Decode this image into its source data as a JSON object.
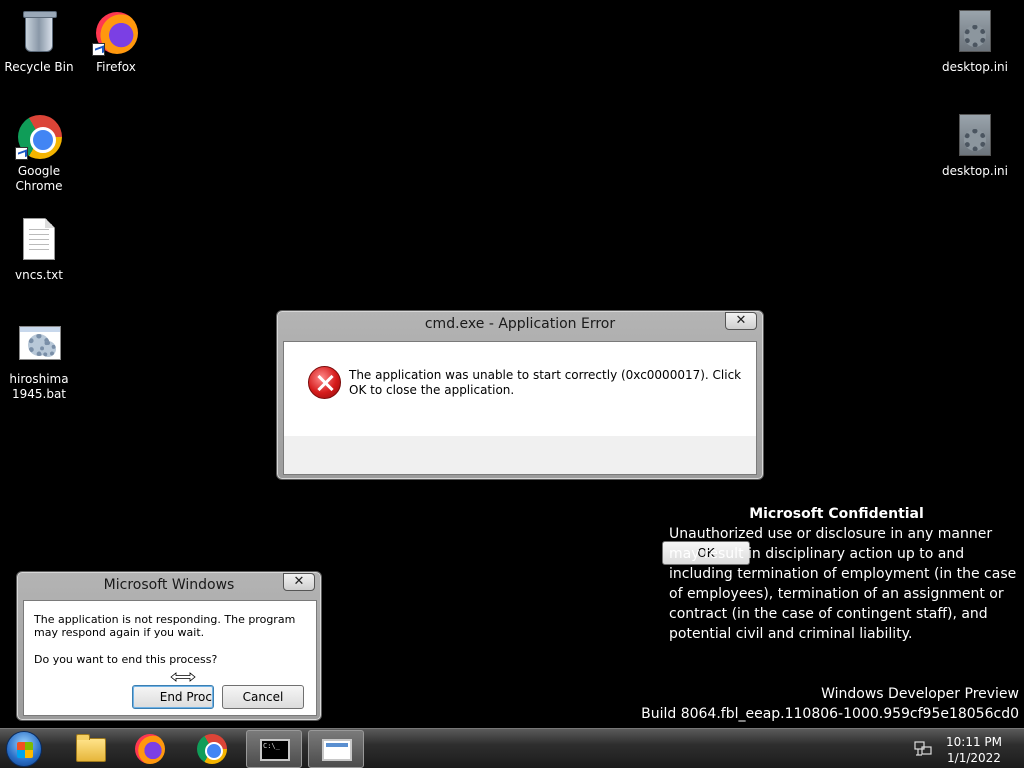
{
  "desktop": {
    "icons": [
      {
        "label": "Recycle Bin",
        "icon": "recycle-bin-icon"
      },
      {
        "label": "Firefox",
        "icon": "firefox-icon"
      },
      {
        "label": "Google Chrome",
        "icon": "chrome-icon"
      },
      {
        "label": "vncs.txt",
        "icon": "text-file-icon"
      },
      {
        "label": "hiroshima 1945.bat",
        "icon": "batch-file-icon"
      },
      {
        "label": "desktop.ini",
        "icon": "ini-file-icon"
      },
      {
        "label": "desktop.ini",
        "icon": "ini-file-icon"
      }
    ]
  },
  "error_dialog": {
    "title": "cmd.exe - Application Error",
    "close": "✕",
    "message": "The application was unable to start correctly (0xc0000017). Click OK to close the application.",
    "ok_label": "OK"
  },
  "not_responding_dialog": {
    "title": "Microsoft Windows",
    "close": "✕",
    "message": "The application is not responding. The program may respond again if you wait.",
    "question": "Do you want to end this process?",
    "end_label": "End Proc",
    "cancel_label": "Cancel"
  },
  "watermark": {
    "heading": "Microsoft Confidential",
    "body": "Unauthorized use or disclosure in any manner may result in disciplinary action up to and including termination of employment (in the case of employees), termination of an assignment or contract (in the case of contingent staff), and potential civil and criminal liability.",
    "edition": "Windows Developer Preview",
    "build": "Build 8064.fbl_eeap.110806-1000.959cf95e18056cd0"
  },
  "taskbar": {
    "cmd_glyph": "C:\\_",
    "clock_time": "10:11 PM",
    "clock_date": "1/1/2022"
  },
  "colors": {
    "desktop_bg": "#000000",
    "error_red": "#d51b1b",
    "focus_blue": "#3c7fb1"
  }
}
